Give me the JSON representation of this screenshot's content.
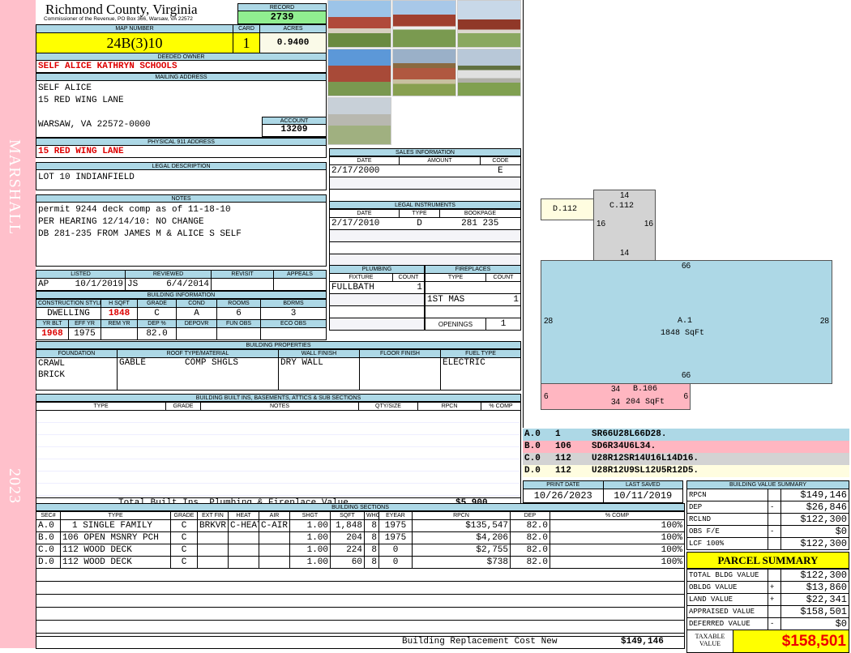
{
  "side": {
    "name": "MARSHALL",
    "year": "2023"
  },
  "header": {
    "title": "Richmond County, Virginia",
    "subtitle": "Commissioner of the Revenue, PO Box 366, Warsaw, VA 22572",
    "record_label": "RECORD",
    "record": "2739"
  },
  "parcel": {
    "map_label": "MAP NUMBER",
    "map": "24B(3)10",
    "card_label": "CARD",
    "card": "1",
    "acres_label": "ACRES",
    "acres": "0.9400"
  },
  "owner": {
    "label": "DEEDED OWNER",
    "name": "SELF ALICE KATHRYN SCHOOLS"
  },
  "mailing": {
    "label": "MAILING ADDRESS",
    "lines": [
      "SELF ALICE",
      "15 RED WING LANE",
      "",
      "WARSAW, VA 22572-0000"
    ],
    "account_label": "ACCOUNT",
    "account": "13209"
  },
  "physical": {
    "label": "PHYSICAL 911 ADDRESS",
    "address": "15 RED WING LANE"
  },
  "legal": {
    "label": "LEGAL DESCRIPTION",
    "text": "LOT 10 INDIANFIELD"
  },
  "notes": {
    "label": "NOTES",
    "lines": [
      "permit 9244 deck comp as of 11-18-10",
      "PER HEARING 12/14/10: NO CHANGE",
      "DB 281-235 FROM JAMES M & ALICE S SELF"
    ]
  },
  "review": {
    "headers": [
      "LISTED",
      "REVIEWED",
      "REVISIT",
      "APPEALS"
    ],
    "listed_by": "AP",
    "listed": "10/1/2019",
    "reviewed_by": "JS",
    "reviewed": "6/4/2014"
  },
  "building_info": {
    "label": "BUILDING INFORMATION",
    "h1": [
      "CONSTRUCTION STYLE",
      "H SQFT",
      "GRADE",
      "COND",
      "ROOMS",
      "BDRMS"
    ],
    "v1": [
      "DWELLING",
      "1848",
      "C",
      "A",
      "6",
      "3"
    ],
    "h2": [
      "YR BLT",
      "EFF YR",
      "REM YR",
      "DEP %",
      "DEPOVR",
      "FUN OBS",
      "ECO OBS"
    ],
    "v2": [
      "1968",
      "1975",
      "",
      "82.0",
      "",
      "",
      ""
    ]
  },
  "properties": {
    "label": "BUILDING PROPERTIES",
    "headers": [
      "FOUNDATION",
      "ROOF TYPE/MATERIAL",
      "WALL FINISH",
      "FLOOR FINISH",
      "FUEL TYPE"
    ],
    "foundation": [
      "CRAWL",
      "BRICK"
    ],
    "roof_type": "GABLE",
    "roof_material": "COMP SHGLS",
    "wall": "DRY WALL",
    "floor": "",
    "fuel": "ELECTRIC"
  },
  "builtins": {
    "label": "BUILDING BUILT INS, BASEMENTS, ATTICS & SUB SECTIONS",
    "headers": [
      "TYPE",
      "GRADE",
      "NOTES",
      "QTY/SIZE",
      "RPCN",
      "% COMP"
    ],
    "total_label": "Total Built Ins, Plumbing & Fireplace Value",
    "total": "$5,900"
  },
  "sales": {
    "label": "SALES INFORMATION",
    "headers": [
      "DATE",
      "AMOUNT",
      "CODE"
    ],
    "rows": [
      [
        "2/17/2000",
        "",
        "E"
      ]
    ]
  },
  "instruments": {
    "label": "LEGAL INSTRUMENTS",
    "headers": [
      "DATE",
      "TYPE",
      "BOOKPAGE"
    ],
    "rows": [
      [
        "2/17/2010",
        "D",
        "281 235"
      ]
    ]
  },
  "plumbing": {
    "label": "PLUMBING",
    "headers": [
      "FIXTURE",
      "COUNT"
    ],
    "rows": [
      [
        "FULLBATH",
        "1"
      ]
    ]
  },
  "fireplaces": {
    "label": "FIREPLACES",
    "headers": [
      "TYPE",
      "COUNT"
    ],
    "rows": [
      [
        "1ST MAS",
        "1"
      ]
    ],
    "openings_label": "OPENINGS",
    "openings": "1"
  },
  "sections": {
    "label": "BUILDING SECTIONS",
    "headers": [
      "SEC#",
      "TYPE",
      "GRADE",
      "EXT FIN",
      "HEAT",
      "AIR",
      "SHGT",
      "SQFT",
      "WHGT",
      "EYEAR",
      "RPCN",
      "DEP",
      "% COMP"
    ],
    "rows": [
      [
        "A.0",
        "1 SINGLE FAMILY",
        "C",
        "BRKVR",
        "C-HEAT",
        "C-AIR",
        "1.00",
        "1,848",
        "8",
        "1975",
        "$135,547",
        "82.0",
        "100%"
      ],
      [
        "B.0",
        "106 OPEN MSNRY PCH",
        "C",
        "",
        "",
        "",
        "1.00",
        "204",
        "8",
        "1975",
        "$4,206",
        "82.0",
        "100%"
      ],
      [
        "C.0",
        "112 WOOD DECK",
        "C",
        "",
        "",
        "",
        "1.00",
        "224",
        "8",
        "0",
        "$2,755",
        "82.0",
        "100%"
      ],
      [
        "D.0",
        "112 WOOD DECK",
        "C",
        "",
        "",
        "",
        "1.00",
        "60",
        "8",
        "0",
        "$738",
        "82.0",
        "100%"
      ]
    ],
    "total_label": "Building Replacement Cost New",
    "total": "$149,146"
  },
  "sketch": {
    "a_label": "A.1",
    "a_area": "1848 SqFt",
    "a_w": "66",
    "a_h": "28",
    "b_label": "B.106",
    "b_area": "204 SqFt",
    "b_w": "34",
    "b_h": "6",
    "c_label": "C.112",
    "c_w": "14",
    "c_h": "16",
    "d_label": "D.112"
  },
  "codes": [
    {
      "sec": "A.0",
      "code": "1",
      "path": "SR66U28L66D28.",
      "color": "#add8e6"
    },
    {
      "sec": "B.0",
      "code": "106",
      "path": "SD6R34U6L34.",
      "color": "#ffb6c1"
    },
    {
      "sec": "C.0",
      "code": "112",
      "path": "U28R12SR14U16L14D16.",
      "color": "#d3d3d3"
    },
    {
      "sec": "D.0",
      "code": "112",
      "path": "U28R12U9SL12U5R12D5.",
      "color": "#fffde0"
    }
  ],
  "dates": {
    "print_label": "PRINT DATE",
    "print": "10/26/2023",
    "saved_label": "LAST SAVED",
    "saved": "10/11/2019"
  },
  "value_summary": {
    "label": "BUILDING VALUE SUMMARY",
    "rows": [
      [
        "RPCN",
        "",
        "$149,146"
      ],
      [
        "DEP",
        "-",
        "$26,846"
      ],
      [
        "RCLND",
        "",
        "$122,300"
      ],
      [
        "OBS F/E",
        "-",
        "$0"
      ],
      [
        "LCF  100%",
        "",
        "$122,300"
      ]
    ]
  },
  "parcel_summary": {
    "label": "PARCEL SUMMARY",
    "rows": [
      [
        "TOTAL BLDG VALUE",
        "",
        "$122,300"
      ],
      [
        "OBLDG VALUE",
        "+",
        "$13,860"
      ],
      [
        "LAND VALUE",
        "+",
        "$22,341"
      ],
      [
        "APPRAISED VALUE",
        "",
        "$158,501"
      ],
      [
        "DEFERRED VALUE",
        "-",
        "$0"
      ]
    ],
    "taxable_label": "TAXABLE VALUE",
    "taxable": "$158,501"
  }
}
